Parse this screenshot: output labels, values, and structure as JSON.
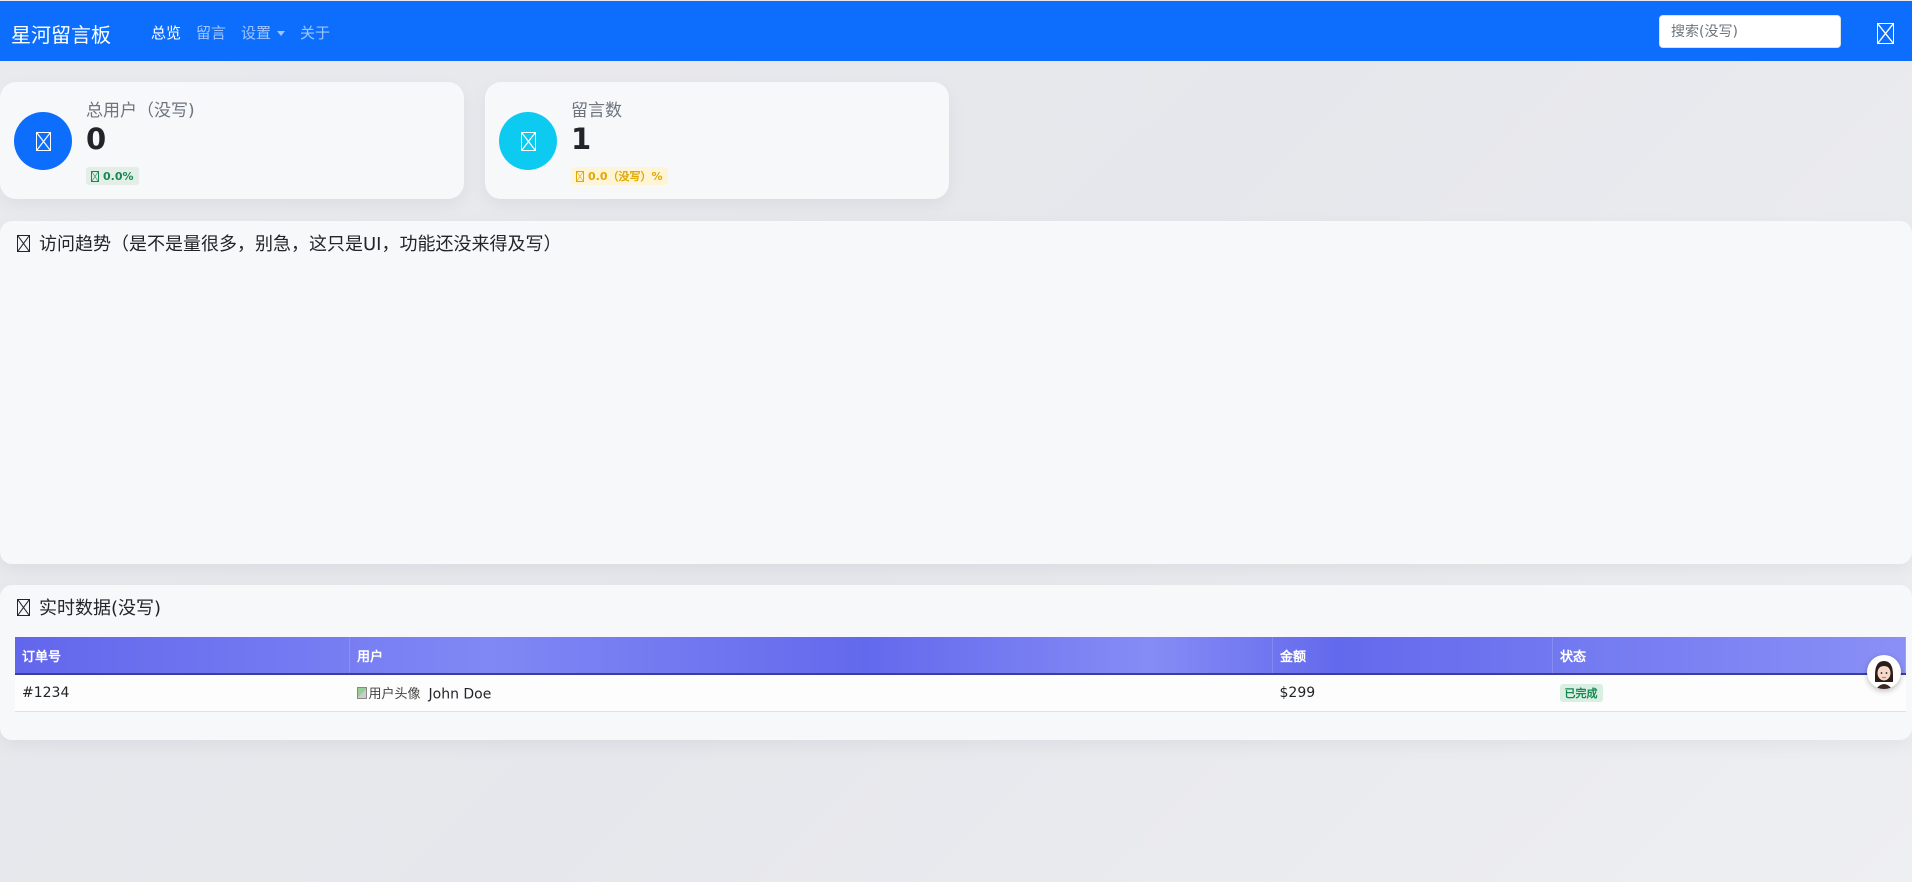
{
  "app": {
    "title": "星河留言板"
  },
  "nav": {
    "items": [
      "总览",
      "留言",
      "设置",
      "关于"
    ]
  },
  "search": {
    "placeholder": "搜索(没写)"
  },
  "stats": [
    {
      "label": "总用户（没写)",
      "value": "0",
      "badge": "0.0%",
      "color": "#0d6efd"
    },
    {
      "label": "留言数",
      "value": "1",
      "badge": "0.0（没写）%",
      "color": "#0dcaf0"
    }
  ],
  "trend": {
    "title": "访问趋势（是不是量很多，别急，这只是UI，功能还没来得及写）"
  },
  "realtime": {
    "title": "实时数据(没写)",
    "columns": [
      "订单号",
      "用户",
      "金额",
      "状态"
    ],
    "rows": [
      {
        "order": "#1234",
        "avatar_alt": "用户头像",
        "user": "John Doe",
        "amount": "$299",
        "status": "已完成"
      }
    ]
  },
  "colors": {
    "navbar": "#0d6efd",
    "success": "#198754",
    "warning": "#e0a800"
  }
}
